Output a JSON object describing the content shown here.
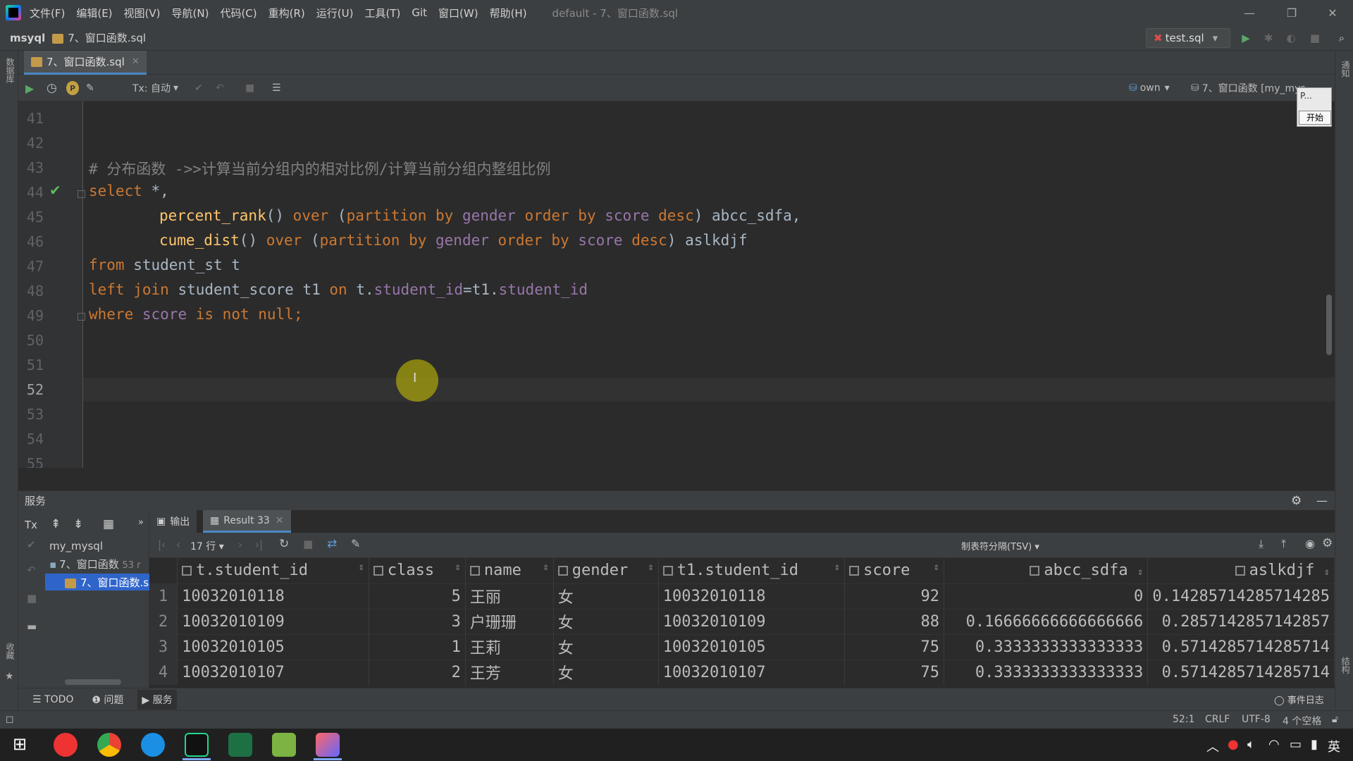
{
  "menubar": {
    "items": [
      "文件(F)",
      "编辑(E)",
      "视图(V)",
      "导航(N)",
      "代码(C)",
      "重构(R)",
      "运行(U)",
      "工具(T)",
      "Git",
      "窗口(W)",
      "帮助(H)"
    ],
    "window_title": "default - 7、窗口函数.sql"
  },
  "navbar": {
    "project": "msyql",
    "file": "7、窗口函数.sql",
    "run_config": "test.sql"
  },
  "editor_tab": {
    "label": "7、窗口函数.sql"
  },
  "editor_toolbar": {
    "tx_mode": "Tx: 自动",
    "schema": "own",
    "datasource": "7、窗口函数 [my_mys..."
  },
  "popup": {
    "text": "P...",
    "button": "开始"
  },
  "editor": {
    "line_numbers": [
      "41",
      "42",
      "43",
      "44",
      "45",
      "46",
      "47",
      "48",
      "49",
      "50",
      "51",
      "52",
      "53",
      "54",
      "55"
    ],
    "current_line": "52",
    "code": {
      "comment": "# 分布函数 ->>计算当前分组内的相对比例/计算当前分组内整组比例",
      "select": "select",
      "star": " *,",
      "percent_rank": "percent_rank",
      "cume_dist": "cume_dist",
      "paren_call": "()",
      "over": "over",
      "open_paren": "(",
      "partition_by": "partition by",
      "gender": "gender",
      "order_by": "order by",
      "score": "score",
      "desc": "desc",
      "close_paren": ")",
      "alias1": " abcc_sdfa,",
      "alias2": " aslkdjf",
      "from": "from",
      "from_rest": " student_st t",
      "left_join": "left join",
      "join_table": " student_score t1 ",
      "on": "on",
      "t_prefix": " t.",
      "student_id": "student_id",
      "eq_t1": "=t1.",
      "where": "where",
      "is_not_null": "is not null",
      "semicolon": ";"
    }
  },
  "services": {
    "title": "服务",
    "tree": {
      "tx": "Tx",
      "root": "my_mysql",
      "child": "7、窗口函数",
      "child_meta": "53 r",
      "leaf": "7、窗口函数.s"
    },
    "tabs": {
      "output": "输出",
      "result": "Result 33"
    },
    "row_count": "17 行",
    "export_format": "制表符分隔(TSV)"
  },
  "results": {
    "columns": [
      "t.student_id",
      "class",
      "name",
      "gender",
      "t1.student_id",
      "score",
      "abcc_sdfa",
      "aslkdjf"
    ],
    "rows": [
      [
        "1",
        "10032010118",
        "5",
        "王丽",
        "女",
        "10032010118",
        "92",
        "0",
        "0.14285714285714285"
      ],
      [
        "2",
        "10032010109",
        "3",
        "户珊珊",
        "女",
        "10032010109",
        "88",
        "0.16666666666666666",
        "0.2857142857142857"
      ],
      [
        "3",
        "10032010105",
        "1",
        "王莉",
        "女",
        "10032010105",
        "75",
        "0.3333333333333333",
        "0.5714285714285714"
      ],
      [
        "4",
        "10032010107",
        "2",
        "王芳",
        "女",
        "10032010107",
        "75",
        "0.3333333333333333",
        "0.5714285714285714"
      ]
    ]
  },
  "bottom_tabs": [
    "TODO",
    "问题",
    "服务"
  ],
  "statusbar": {
    "event_log": "事件日志",
    "position": "52:1",
    "line_sep": "CRLF",
    "encoding": "UTF-8",
    "indent": "4 个空格"
  },
  "side_labels": {
    "left_top": "数据库",
    "left_bottom": "收藏",
    "right_top": "通知",
    "right_bottom": "结构"
  },
  "taskbar": {
    "ime": "英"
  },
  "colors": {
    "accent": "#4a88c7",
    "keyword": "#cc7832",
    "function": "#ffc66d",
    "column": "#9876aa",
    "comment": "#808080"
  }
}
